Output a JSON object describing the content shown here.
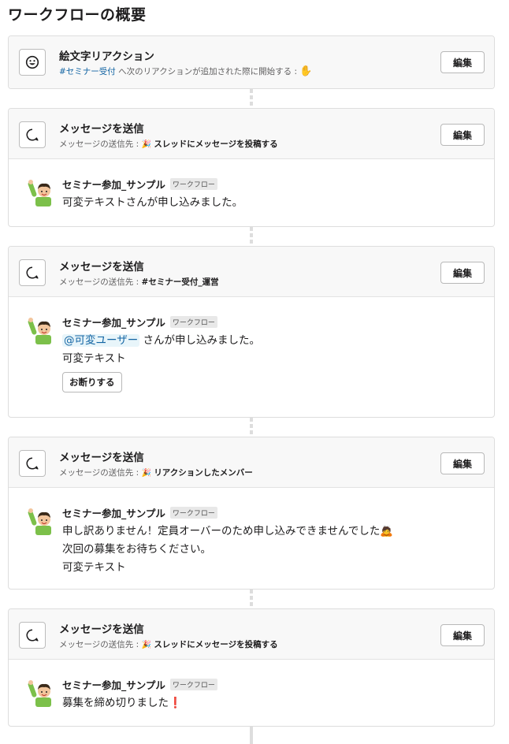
{
  "page_title": "ワークフローの概要",
  "edit_label": "編集",
  "trigger": {
    "title": "絵文字リアクション",
    "channel": "#セミナー受付",
    "description": "へ次のリアクションが追加された際に開始する :",
    "reaction_emoji": "✋",
    "icon": "emoji-smile-icon"
  },
  "steps": [
    {
      "title": "メッセージを送信",
      "dest_prefix": "メッセージの送信先 :",
      "dest_icon": "🎉",
      "dest": "スレッドにメッセージを投稿する",
      "sender": "セミナー参加_サンプル",
      "tag": "ワークフロー",
      "lines": [
        "可変テキストさんが申し込みました。"
      ]
    },
    {
      "title": "メッセージを送信",
      "dest_prefix": "メッセージの送信先 :",
      "dest": "#セミナー受付_運営",
      "sender": "セミナー参加_サンプル",
      "tag": "ワークフロー",
      "mention": "@可変ユーザー",
      "mention_tail": "さんが申し込みました。",
      "lines": [
        "可変テキスト"
      ],
      "button_label": "お断りする"
    },
    {
      "title": "メッセージを送信",
      "dest_prefix": "メッセージの送信先 :",
      "dest_icon": "🎉",
      "dest": "リアクションしたメンバー",
      "sender": "セミナー参加_サンプル",
      "tag": "ワークフロー",
      "lines": [
        "申し訳ありません！定員オーバーのため申し込みできませんでした",
        "次回の募集をお待ちください。",
        "可変テキスト"
      ],
      "line_emoji": "🙇"
    },
    {
      "title": "メッセージを送信",
      "dest_prefix": "メッセージの送信先 :",
      "dest_icon": "🎉",
      "dest": "スレッドにメッセージを投稿する",
      "sender": "セミナー参加_サンプル",
      "tag": "ワークフロー",
      "lines": [
        "募集を締め切りました"
      ],
      "line_emoji": "❗"
    }
  ]
}
